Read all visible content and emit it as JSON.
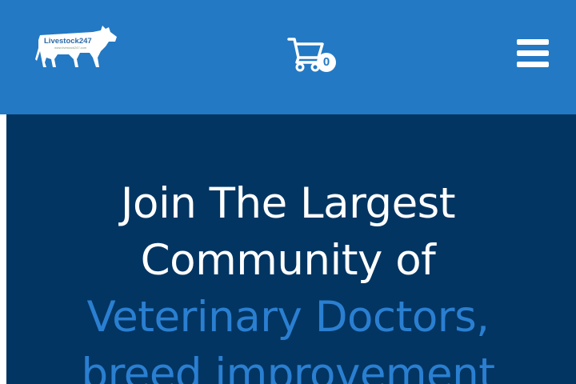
{
  "header": {
    "logo_text": "Livestock247",
    "logo_subtext": "www.livestock247.com",
    "cart_count": "0",
    "icons": {
      "logo": "cow-logo-icon",
      "cart": "shopping-cart-icon",
      "menu": "hamburger-menu-icon"
    }
  },
  "hero": {
    "line1": "Join The Largest",
    "line2": "Community of",
    "line3": "Veterinary Doctors,",
    "line4": "breed improvement"
  },
  "colors": {
    "header_bg": "#2379c4",
    "hero_bg": "#033562",
    "accent_text": "#2a7fd1",
    "logo_green": "#3a8a3a"
  }
}
